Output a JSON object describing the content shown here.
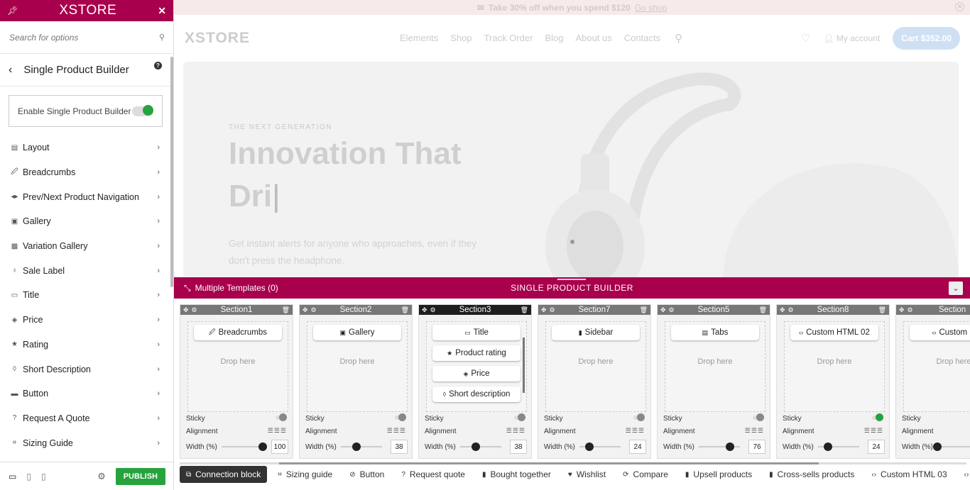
{
  "sidebar": {
    "logo": "XSTORE",
    "search_placeholder": "Search for options",
    "section_title": "Single Product Builder",
    "help": "?",
    "enable_label": "Enable Single Product Builder",
    "enable_on": true,
    "items": [
      {
        "label": "Layout",
        "icon": "layout-icon",
        "glyph": "▤"
      },
      {
        "label": "Breadcrumbs",
        "icon": "breadcrumbs-icon",
        "glyph": "🖉"
      },
      {
        "label": "Prev/Next Product Navigation",
        "icon": "navigation-icon",
        "glyph": "◂▸"
      },
      {
        "label": "Gallery",
        "icon": "gallery-icon",
        "glyph": "▣"
      },
      {
        "label": "Variation Gallery",
        "icon": "variation-gallery-icon",
        "glyph": "▩"
      },
      {
        "label": "Sale Label",
        "icon": "sale-label-icon",
        "glyph": "♁"
      },
      {
        "label": "Title",
        "icon": "title-icon",
        "glyph": "▭"
      },
      {
        "label": "Price",
        "icon": "price-icon",
        "glyph": "◈"
      },
      {
        "label": "Rating",
        "icon": "star-icon",
        "glyph": "★"
      },
      {
        "label": "Short Description",
        "icon": "short-description-icon",
        "glyph": "◊"
      },
      {
        "label": "Button",
        "icon": "button-icon",
        "glyph": "▬"
      },
      {
        "label": "Request A Quote",
        "icon": "question-icon",
        "glyph": "?"
      },
      {
        "label": "Sizing Guide",
        "icon": "sizing-guide-icon",
        "glyph": "⌗"
      }
    ],
    "publish_label": "PUBLISH"
  },
  "preview": {
    "promo_text": "Take 30% off when you spend $120",
    "promo_link": "Go shop",
    "site_logo": "XSTORE",
    "menu": [
      "Elements",
      "Shop",
      "Track Order",
      "Blog",
      "About us",
      "Contacts"
    ],
    "account": "My account",
    "cart": "Cart $352.00",
    "hero_kicker": "THE NEXT GENERATION",
    "hero_title_line1": "Innovation That",
    "hero_title_line2": "Dri",
    "hero_text": "Get instant alerts for anyone who approaches, even if they don't press the headphone."
  },
  "builder": {
    "multiple_templates": "Multiple Templates (0)",
    "title": "SINGLE PRODUCT BUILDER",
    "labels": {
      "sticky": "Sticky",
      "alignment": "Alignment",
      "width": "Width (%)",
      "drop_here": "Drop here"
    },
    "sections": [
      {
        "name": "Section1",
        "elements": [
          {
            "label": "Breadcrumbs",
            "glyph": "🖉"
          }
        ],
        "sticky": false,
        "width": 100,
        "active": false
      },
      {
        "name": "Section2",
        "elements": [
          {
            "label": "Gallery",
            "glyph": "▣"
          }
        ],
        "sticky": false,
        "width": 38,
        "active": false
      },
      {
        "name": "Section3",
        "elements": [
          {
            "label": "Title",
            "glyph": "▭"
          },
          {
            "label": "Product rating",
            "glyph": "★"
          },
          {
            "label": "Price",
            "glyph": "◈"
          },
          {
            "label": "Short description",
            "glyph": "◊"
          }
        ],
        "sticky": false,
        "width": 38,
        "active": true
      },
      {
        "name": "Section7",
        "elements": [
          {
            "label": "Sidebar",
            "glyph": "▮"
          }
        ],
        "sticky": false,
        "width": 24,
        "active": false
      },
      {
        "name": "Section5",
        "elements": [
          {
            "label": "Tabs",
            "glyph": "▤"
          }
        ],
        "sticky": false,
        "width": 76,
        "active": false
      },
      {
        "name": "Section8",
        "elements": [
          {
            "label": "Custom HTML 02",
            "glyph": "‹›"
          }
        ],
        "sticky": true,
        "width": 24,
        "active": false
      },
      {
        "name": "Section",
        "elements": [
          {
            "label": "Custom H",
            "glyph": "‹›"
          }
        ],
        "sticky": false,
        "width": null,
        "active": false
      }
    ],
    "tabs": [
      {
        "label": "Connection block",
        "icon": "connection-icon",
        "glyph": "⧉",
        "active": true
      },
      {
        "label": "Sizing guide",
        "icon": "sizing-guide-icon",
        "glyph": "⌗"
      },
      {
        "label": "Button",
        "icon": "button-icon",
        "glyph": "⊘"
      },
      {
        "label": "Request quote",
        "icon": "question-icon",
        "glyph": "?"
      },
      {
        "label": "Bought together",
        "icon": "bag-icon",
        "glyph": "▮"
      },
      {
        "label": "Wishlist",
        "icon": "heart-icon",
        "glyph": "♥"
      },
      {
        "label": "Compare",
        "icon": "compare-icon",
        "glyph": "⟳"
      },
      {
        "label": "Upsell products",
        "icon": "bag-icon",
        "glyph": "▮"
      },
      {
        "label": "Cross-sells products",
        "icon": "bag-icon",
        "glyph": "▮"
      },
      {
        "label": "Custom HTML 03",
        "icon": "code-icon",
        "glyph": "‹›"
      },
      {
        "label": "",
        "icon": "code-icon",
        "glyph": "‹›"
      }
    ]
  },
  "colors": {
    "brand": "#a8004c",
    "success": "#27a33d",
    "active_section": "#1e1e1e"
  }
}
